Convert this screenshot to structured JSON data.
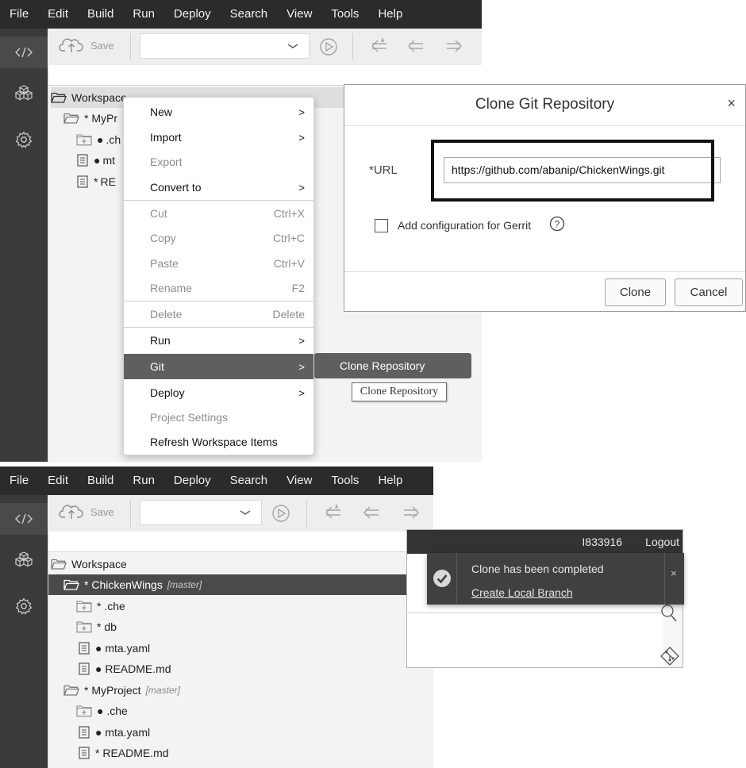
{
  "menubar": {
    "items": [
      "File",
      "Edit",
      "Build",
      "Run",
      "Deploy",
      "Search",
      "View",
      "Tools",
      "Help"
    ]
  },
  "leftbar": {
    "icons": [
      "code-icon",
      "packages-icon",
      "gear-icon"
    ]
  },
  "toolbar": {
    "save_label": "Save",
    "icons": [
      "cloud-save-icon",
      "chevron-down-icon",
      "run-icon",
      "back-history-icon",
      "back-icon",
      "forward-icon"
    ]
  },
  "tree_top": {
    "workspace": "Workspace",
    "project": "* MyPr",
    "items": [
      {
        "prefix": "●",
        "name": ".ch",
        "icon": "folder-plus-icon"
      },
      {
        "prefix": "●",
        "name": "mt",
        "icon": "file-icon"
      },
      {
        "prefix": "*",
        "name": "RE",
        "icon": "file-icon"
      }
    ]
  },
  "context_menu": {
    "items": [
      {
        "label": "New",
        "submenu": true,
        "disabled": false
      },
      {
        "label": "Import",
        "submenu": true,
        "disabled": false
      },
      {
        "label": "Export",
        "disabled": true
      },
      {
        "label": "Convert to",
        "submenu": true,
        "disabled": false
      },
      {
        "label": "Cut",
        "shortcut": "Ctrl+X",
        "disabled": true
      },
      {
        "label": "Copy",
        "shortcut": "Ctrl+C",
        "disabled": true
      },
      {
        "label": "Paste",
        "shortcut": "Ctrl+V",
        "disabled": true
      },
      {
        "label": "Rename",
        "shortcut": "F2",
        "disabled": true
      },
      {
        "label": "Delete",
        "shortcut": "Delete",
        "disabled": true
      },
      {
        "label": "Run",
        "submenu": true,
        "disabled": false
      },
      {
        "label": "Git",
        "submenu": true,
        "disabled": false,
        "highlighted": true
      },
      {
        "label": "Deploy",
        "submenu": true,
        "disabled": false
      },
      {
        "label": "Project Settings",
        "disabled": true
      },
      {
        "label": "Refresh Workspace Items",
        "disabled": false
      }
    ],
    "arrow": ">"
  },
  "git_submenu": {
    "item": "Clone Repository",
    "tooltip": "Clone Repository"
  },
  "clone_dialog": {
    "title": "Clone Git Repository",
    "close": "×",
    "url_label": "*URL",
    "url_value": "https://github.com/abanip/ChickenWings.git",
    "checkbox_label": "Add configuration for Gerrit",
    "checkbox_checked": false,
    "help": "?",
    "clone_button": "Clone",
    "cancel_button": "Cancel"
  },
  "tree_bottom": {
    "workspace": "Workspace",
    "projects": [
      {
        "name": "* ChickenWings",
        "branch": "[master]",
        "selected": true,
        "children": [
          {
            "name": "* .che",
            "icon": "folder-plus-icon"
          },
          {
            "name": "* db",
            "icon": "folder-plus-icon"
          },
          {
            "name": "● mta.yaml",
            "icon": "file-icon"
          },
          {
            "name": "● README.md",
            "icon": "file-icon"
          }
        ]
      },
      {
        "name": "* MyProject",
        "branch": "[master]",
        "selected": false,
        "children": [
          {
            "name": "● .che",
            "icon": "folder-plus-icon"
          },
          {
            "name": "● mta.yaml",
            "icon": "file-icon"
          },
          {
            "name": "* README.md",
            "icon": "file-icon"
          }
        ]
      }
    ]
  },
  "notification": {
    "user": "I833916",
    "logout": "Logout",
    "message": "Clone has been completed",
    "link": "Create Local Branch",
    "close": "×",
    "rail_icons": [
      "search-icon",
      "git-icon"
    ]
  },
  "colors": {
    "menubar_bg": "#2b2b2b",
    "sidebar_bg": "#3a3a3a",
    "highlight_bg": "#5f5f5f",
    "selected_row_bg": "#4a4a4a",
    "toast_bg": "#404040"
  }
}
